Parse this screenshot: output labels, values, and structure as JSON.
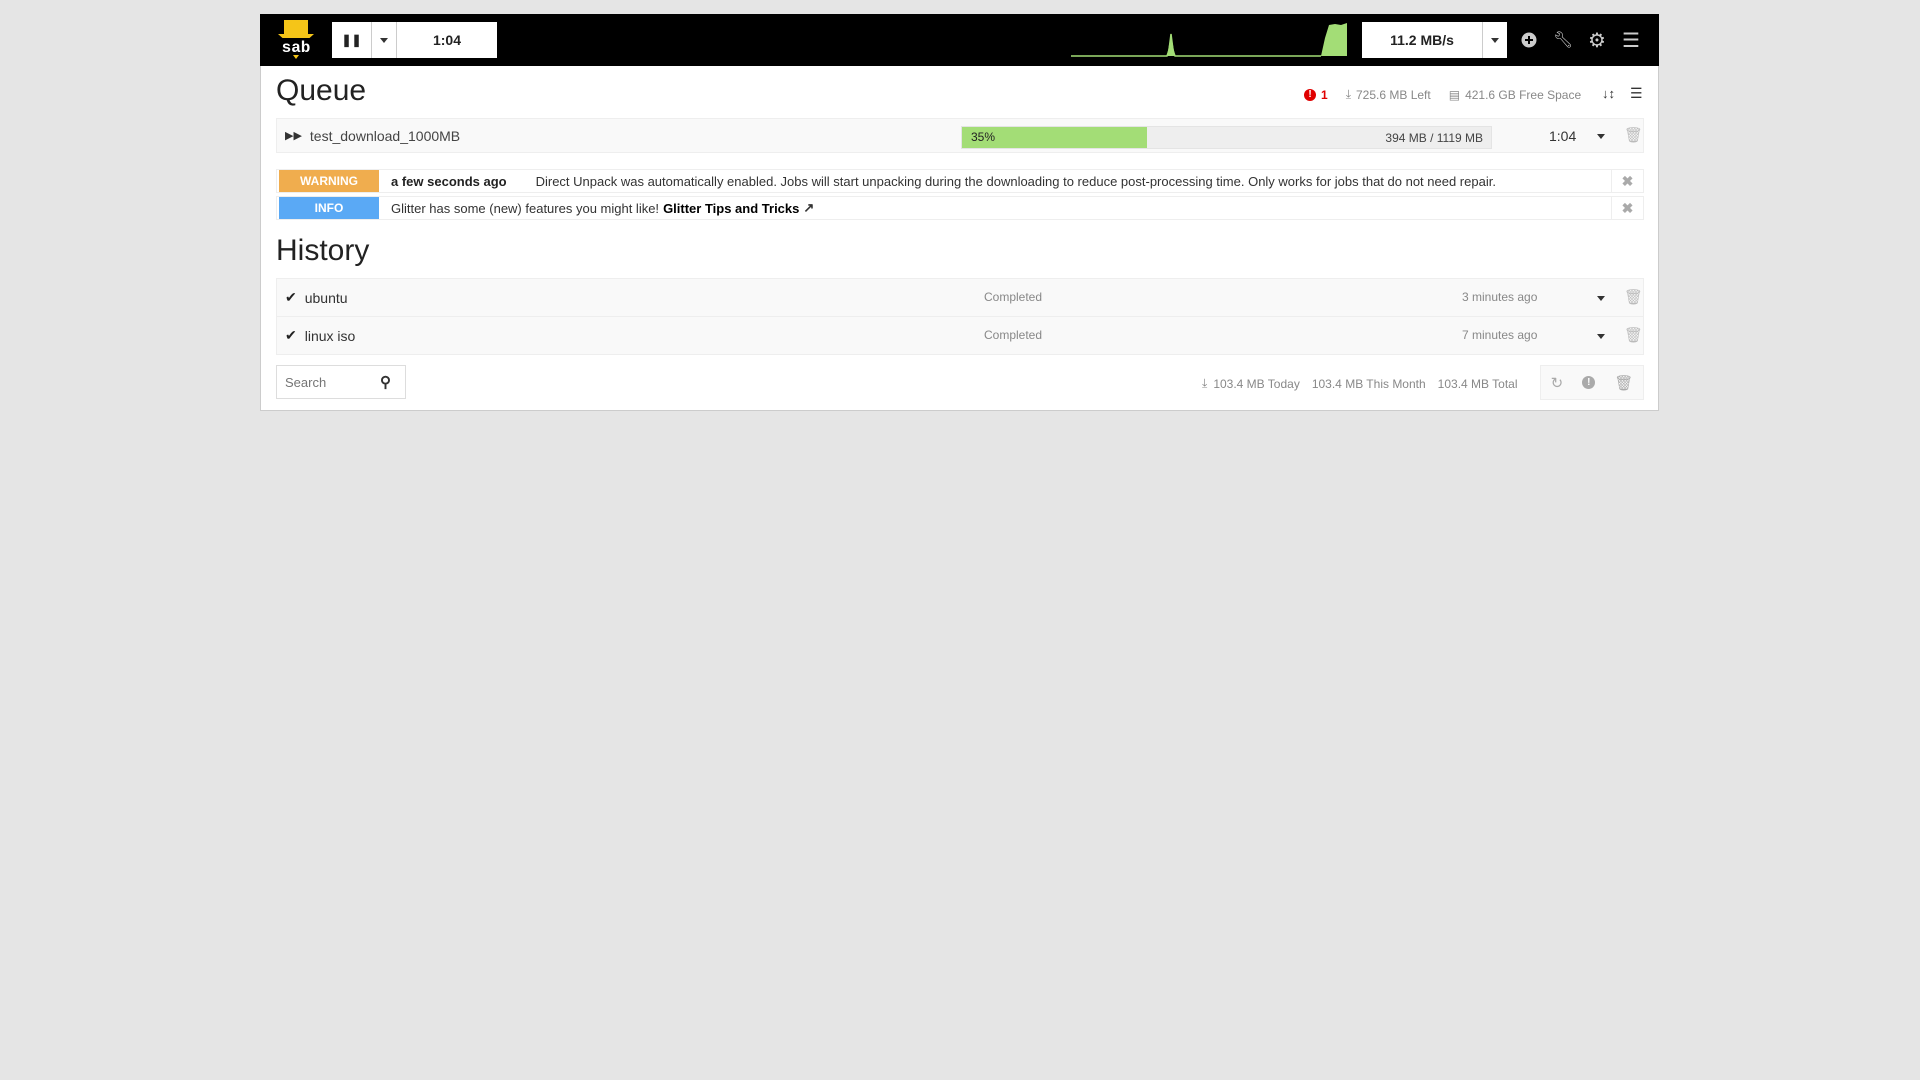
{
  "colors": {
    "accent": "#f0ad4e",
    "progress": "#a3dd76",
    "warning": "#f0ad4e",
    "info": "#5aa9f5",
    "error": "#e00000"
  },
  "topbar": {
    "logo_text": "sab",
    "pause_icon": "pause-icon",
    "timeleft": "1:04",
    "speed": "11.2 MB/s",
    "icons": [
      "plus-circle-icon",
      "wrench-icon",
      "gear-icon",
      "menu-icon"
    ]
  },
  "queue": {
    "title": "Queue",
    "error_count": "1",
    "left": "725.6 MB Left",
    "free_space": "421.6 GB Free Space",
    "items": [
      {
        "name": "test_download_1000MB",
        "progress_percent": 35,
        "progress_label": "35%",
        "size": "394 MB / 1119 MB",
        "timeleft": "1:04"
      }
    ]
  },
  "messages": [
    {
      "type": "WARNING",
      "time": "a few seconds ago",
      "text": "Direct Unpack was automatically enabled. Jobs will start unpacking during the downloading to reduce post-processing time. Only works for jobs that do not need repair."
    },
    {
      "type": "INFO",
      "text": "Glitter has some (new) features you might like!",
      "link": "Glitter Tips and Tricks"
    }
  ],
  "history": {
    "title": "History",
    "items": [
      {
        "name": "ubuntu",
        "status": "Completed",
        "time": "3 minutes ago"
      },
      {
        "name": "linux iso",
        "status": "Completed",
        "time": "7 minutes ago"
      }
    ],
    "search_placeholder": "Search",
    "today": "103.4 MB Today",
    "month": "103.4 MB This Month",
    "total": "103.4 MB Total"
  }
}
